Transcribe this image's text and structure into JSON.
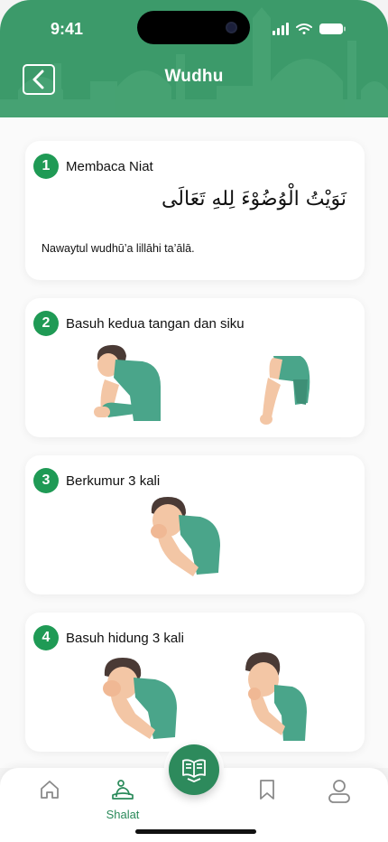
{
  "status_bar": {
    "time": "9:41"
  },
  "header": {
    "title": "Wudhu"
  },
  "steps": [
    {
      "number": "1",
      "title": "Membaca Niat",
      "arabic": "نَوَيْتُ الْوُضُوْءَ لِلهِ تَعَالَى",
      "latin": "Nawaytul wudhū’a lillāhi ta’ālā."
    },
    {
      "number": "2",
      "title": "Basuh kedua tangan dan siku"
    },
    {
      "number": "3",
      "title": "Berkumur 3 kali"
    },
    {
      "number": "4",
      "title": "Basuh hidung 3 kali"
    }
  ],
  "nav": {
    "items": [
      {
        "icon": "home-icon"
      },
      {
        "icon": "shalat-icon",
        "label": "Shalat"
      },
      {
        "icon": "quran-icon"
      },
      {
        "icon": "bookmark-icon"
      },
      {
        "icon": "profile-icon"
      }
    ]
  },
  "colors": {
    "primary": "#3c9a6a",
    "accent": "#1f9a55",
    "shirt": "#4aa58a",
    "skin": "#f3c6a5",
    "hair": "#4a3a35"
  }
}
